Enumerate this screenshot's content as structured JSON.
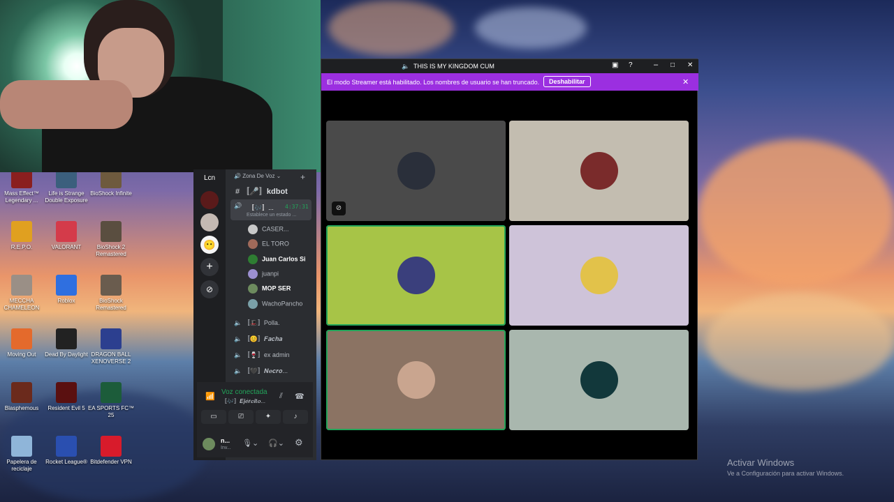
{
  "desktop": {
    "icons": [
      {
        "label": "Mass Effect™ Legendary ...",
        "color": "#8a1f1f"
      },
      {
        "label": "Life is Strange Double Exposure",
        "color": "#3b5f7d"
      },
      {
        "label": "BioShock Infinite",
        "color": "#6e5a3e"
      },
      {
        "label": "R.E.P.O.",
        "color": "#e0a020"
      },
      {
        "label": "VALORANT",
        "color": "#d43b4a"
      },
      {
        "label": "BioShock 2 Remastered",
        "color": "#5a4e40"
      },
      {
        "label": "MECCHA CHAMELEON",
        "color": "#9a8f86"
      },
      {
        "label": "Roblox",
        "color": "#2f6fe0"
      },
      {
        "label": "BioShock Remastered",
        "color": "#6a5c4e"
      },
      {
        "label": "Moving Out",
        "color": "#e46a2c"
      },
      {
        "label": "Dead By Daylight",
        "color": "#222222"
      },
      {
        "label": "DRAGON BALL XENOVERSE 2",
        "color": "#2c3f8f"
      },
      {
        "label": "Blasphemous",
        "color": "#6b2a1c"
      },
      {
        "label": "Resident Evil 5",
        "color": "#5a1010"
      },
      {
        "label": "EA SPORTS FC™ 25",
        "color": "#1c5c3a"
      },
      {
        "label": "Papelera de reciclaje",
        "color": "#8fb5d9"
      },
      {
        "label": "Rocket League®",
        "color": "#2a4fb0"
      },
      {
        "label": "Bitdefender VPN",
        "color": "#d81b2b"
      }
    ],
    "watermark_title": "Activar Windows",
    "watermark_sub": "Ve a Configuración para activar Windows."
  },
  "discord_sidebar": {
    "server_name": "Lcn",
    "voice_zone": "Zona De Voz",
    "text_channel": "kdbot",
    "voice_channel_name": "〚🎶〛...",
    "voice_timer": "4:37:31",
    "voice_status": "Establece un estado ...",
    "members": [
      {
        "name": "CASER...",
        "color": "#c8c8c8"
      },
      {
        "name": "EL TORO",
        "color": "#a06a5a"
      },
      {
        "name": "Juan Carlos Si",
        "color": "#2e7d32",
        "bold": true
      },
      {
        "name": "juanpi",
        "color": "#9b8fd0"
      },
      {
        "name": "MOP SER",
        "color": "#6d8b5e",
        "bold": true
      },
      {
        "name": "WachoPancho",
        "color": "#7aa0a8"
      }
    ],
    "other_channels": [
      "〚🎩〛Polla.",
      "〚😊〛𝑭𝒂𝒄𝒉𝒂",
      "〚🍷〛ex admin",
      "〚🖤〛𝑵𝒆𝒄𝒓𝒐..."
    ],
    "voice_connected": "Voz conectada",
    "voice_connected_sub": "〚🎶〛𝑬𝒋𝒆́𝒓𝒄𝒊𝒕𝒐...",
    "user_name": "n...",
    "user_status": "Inv..."
  },
  "window": {
    "title": "THIS IS MY KINGDOM CUM",
    "banner_text": "El modo Streamer está habilitado. Los nombres de usuario se han truncado.",
    "banner_button": "Deshabilitar",
    "tiles": [
      {
        "bg": "#4a4a4a",
        "avatar": "#2a2f3a",
        "speaking": false,
        "muted_icon": true
      },
      {
        "bg": "#c3bdb0",
        "avatar": "#7a2b2b",
        "speaking": false,
        "muted_icon": false
      },
      {
        "bg": "#a7c447",
        "avatar": "#3a3f7c",
        "speaking": true,
        "muted_icon": false
      },
      {
        "bg": "#cec3d9",
        "avatar": "#e2c24a",
        "speaking": false,
        "muted_icon": false
      },
      {
        "bg": "#8b7363",
        "avatar": "#c9a58f",
        "speaking": true,
        "muted_icon": false
      },
      {
        "bg": "#a9b7ae",
        "avatar": "#12383b",
        "speaking": false,
        "muted_icon": false
      }
    ]
  }
}
